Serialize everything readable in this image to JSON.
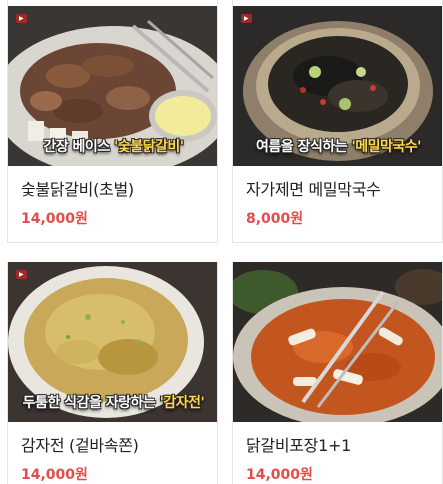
{
  "products": [
    {
      "name": "숯불닭갈비(초벌)",
      "price": "14,000원",
      "caption_prefix": "간장 베이스 ",
      "caption_highlight": "'숯불닭갈비'",
      "image": "grilled-chicken-image"
    },
    {
      "name": "자가제면 메밀막국수",
      "price": "8,000원",
      "caption_prefix": "여름을 장식하는 ",
      "caption_highlight": "'메밀막국수'",
      "image": "buckwheat-noodles-image"
    },
    {
      "name": "감자전 (겉바속쫀)",
      "price": "14,000원",
      "caption_prefix": "두툼한 식감을 자랑하는 ",
      "caption_highlight": "'감자전'",
      "image": "potato-pancake-image"
    },
    {
      "name": "닭갈비포장1+1",
      "price": "14,000원",
      "caption_prefix": "",
      "caption_highlight": "",
      "image": "spicy-chicken-takeout-image"
    }
  ],
  "colors": {
    "price": "#e64a4a",
    "caption_highlight": "#ffd84a",
    "border": "#e4e4e4"
  }
}
